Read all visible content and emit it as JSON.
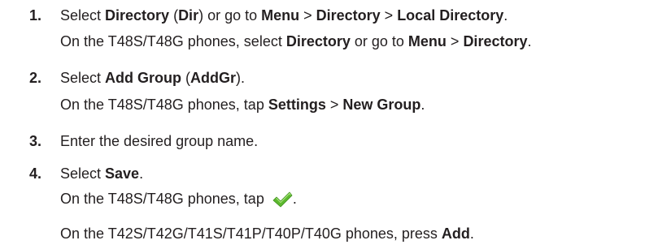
{
  "steps": [
    {
      "number": "1.",
      "main": {
        "t1": "Select ",
        "b1": "Directory",
        "t2": " (",
        "b2": "Dir",
        "t3": ") or go to ",
        "b3": "Menu",
        "t4": " > ",
        "b4": "Directory",
        "t5": " > ",
        "b5": "Local Directory",
        "t6": "."
      },
      "note": {
        "t1": "On the T48S/T48G phones, select ",
        "b1": "Directory",
        "t2": " or go to ",
        "b2": "Menu",
        "t3": " > ",
        "b3": "Directory",
        "t4": "."
      }
    },
    {
      "number": "2.",
      "main": {
        "t1": "Select ",
        "b1": "Add Group",
        "t2": " (",
        "b2": "AddGr",
        "t3": ")."
      },
      "note": {
        "t1": "On the T48S/T48G phones, tap ",
        "b1": "Settings",
        "t2": " > ",
        "b2": "New Group",
        "t3": "."
      }
    },
    {
      "number": "3.",
      "main": {
        "t1": "Enter the desired group name."
      }
    },
    {
      "number": "4.",
      "main": {
        "t1": "Select ",
        "b1": "Save",
        "t2": "."
      },
      "note": {
        "t1": "On the T48S/T48G phones, tap ",
        "t2": "."
      },
      "note2": {
        "t1": "On the T42S/T42G/T41S/T41P/T40P/T40G phones, press ",
        "b1": "Add",
        "t2": "."
      }
    }
  ],
  "icons": {
    "checkmark": "checkmark-icon",
    "checkmark_color": "#5cb82e"
  }
}
